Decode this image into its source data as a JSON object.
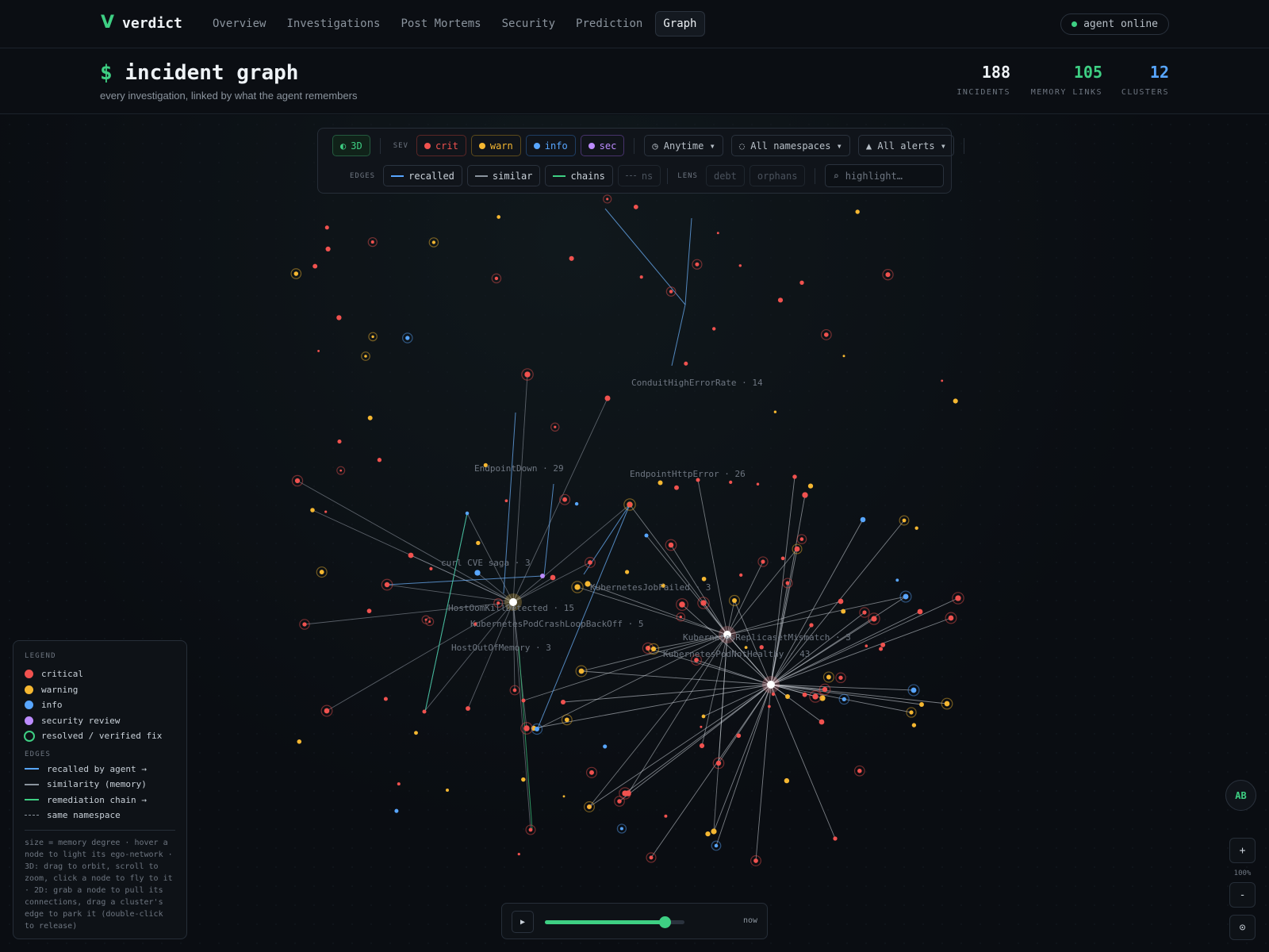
{
  "app": {
    "brand_mark": "V",
    "brand_name": "verdict"
  },
  "nav": {
    "tabs": [
      {
        "label": "Overview",
        "active": false
      },
      {
        "label": "Investigations",
        "active": false
      },
      {
        "label": "Post Mortems",
        "active": false
      },
      {
        "label": "Security",
        "active": false
      },
      {
        "label": "Prediction",
        "active": false
      },
      {
        "label": "Graph",
        "active": true
      }
    ],
    "agent_status": "agent online"
  },
  "header": {
    "prompt": "$",
    "title": "incident graph",
    "subtitle": "every investigation, linked by what the agent remembers",
    "stats": [
      {
        "value": "188",
        "label": "INCIDENTS",
        "color": "#eef2f6"
      },
      {
        "value": "105",
        "label": "MEMORY LINKS",
        "color": "#3ecf83"
      },
      {
        "value": "12",
        "label": "CLUSTERS",
        "color": "#58a6ff"
      }
    ]
  },
  "toolbar": {
    "mode": "3D",
    "mode_icon": "◐",
    "sev_label": "SEV",
    "severities": [
      {
        "label": "crit",
        "color": "#f0524f"
      },
      {
        "label": "warn",
        "color": "#f5b731"
      },
      {
        "label": "info",
        "color": "#58a6ff"
      },
      {
        "label": "sec",
        "color": "#bc8cff"
      }
    ],
    "time_filter": "◷ Anytime ▾",
    "namespace_filter": "◌ All namespaces ▾",
    "alert_filter": "▲ All alerts ▾",
    "edges_label": "EDGES",
    "edges": [
      {
        "label": "recalled",
        "color": "#58a6ff",
        "active": true
      },
      {
        "label": "similar",
        "color": "#8b949e",
        "active": true
      },
      {
        "label": "chains",
        "color": "#3ecf83",
        "active": true
      },
      {
        "label": "ns",
        "color": "#4a525c",
        "active": false
      }
    ],
    "lens_label": "LENS",
    "lenses": [
      "debt",
      "orphans"
    ],
    "search_icon": "⌕",
    "search_placeholder": "highlight…"
  },
  "clusters": [
    {
      "label": "ConduitHighErrorRate · 14"
    },
    {
      "label": "EndpointDown · 29"
    },
    {
      "label": "EndpointHttpError · 26"
    },
    {
      "label": "curl CVE saga · 3"
    },
    {
      "label": "KubernetesJobFailed · 3"
    },
    {
      "label": "HostOomKillDetected · 15"
    },
    {
      "label": "KubernetesPodCrashLoopBackOff · 5"
    },
    {
      "label": "KubernetesReplicasetMismatch · 3"
    },
    {
      "label": "HostOutOfMemory · 3"
    },
    {
      "label": "KubernetesPodNotHealthy · 43"
    }
  ],
  "legend": {
    "title": "LEGEND",
    "items": [
      {
        "label": "critical",
        "color": "#f0524f"
      },
      {
        "label": "warning",
        "color": "#f5b731"
      },
      {
        "label": "info",
        "color": "#58a6ff"
      },
      {
        "label": "security review",
        "color": "#bc8cff"
      },
      {
        "label": "resolved / verified fix",
        "color": "#3ecf83"
      }
    ],
    "edges_title": "EDGES",
    "edges": [
      {
        "label": "recalled by agent →",
        "color": "#58a6ff"
      },
      {
        "label": "similarity (memory)",
        "color": "#8b949e"
      },
      {
        "label": "remediation chain →",
        "color": "#3ecf83"
      },
      {
        "label": "same namespace",
        "color": "#8b949e"
      }
    ],
    "note": "size = memory degree · hover a node to light its ego-network · 3D: drag to orbit, scroll to zoom, click a node to fly to it · 2D: grab a node to pull its connections, drag a cluster's edge to park it (double-click to release)"
  },
  "timeline": {
    "play_icon": "▶",
    "progress": 0.86,
    "label": "now"
  },
  "user": {
    "initials": "AB"
  },
  "zoom": {
    "plus": "+",
    "level": "100%",
    "minus": "-",
    "recenter_icon": "⊙"
  }
}
